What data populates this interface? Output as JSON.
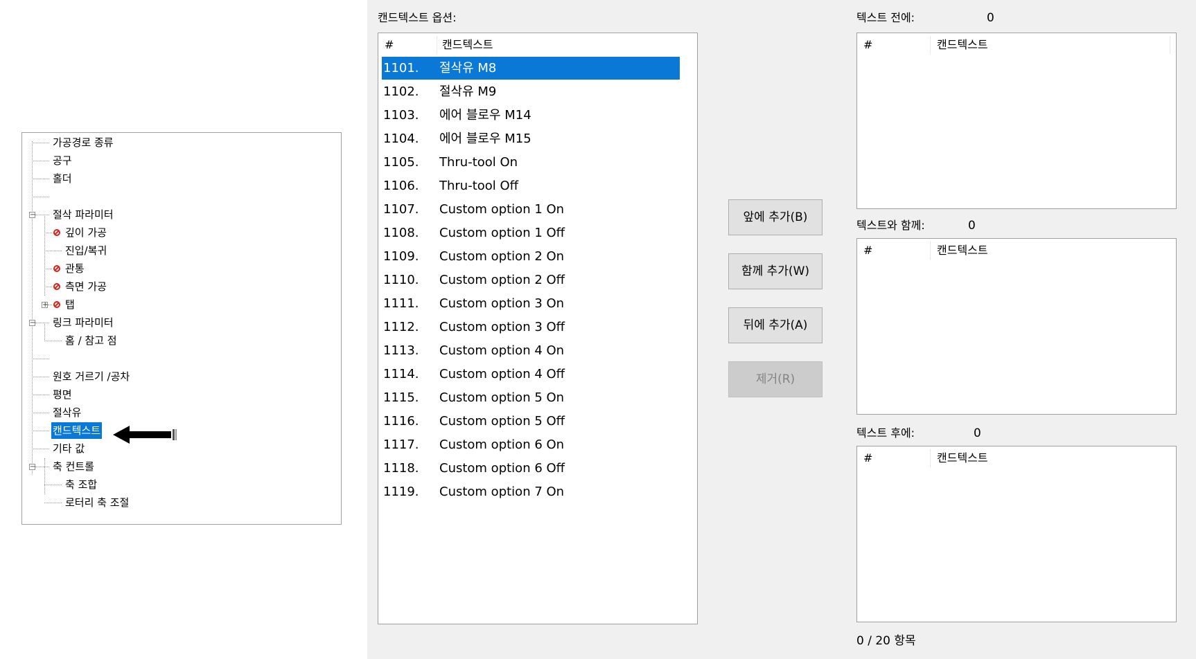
{
  "tree": {
    "items": [
      {
        "label": "가공경로 종류"
      },
      {
        "label": "공구"
      },
      {
        "label": "홀더"
      },
      {
        "label": ""
      },
      {
        "label": "절삭 파라미터"
      },
      {
        "label": "깊이 가공"
      },
      {
        "label": "진입/복귀"
      },
      {
        "label": "관통"
      },
      {
        "label": "측면 가공"
      },
      {
        "label": "탭"
      },
      {
        "label": "링크 파라미터"
      },
      {
        "label": "홈 / 참고 점"
      },
      {
        "label": ""
      },
      {
        "label": "원호 거르기 /공차"
      },
      {
        "label": "평면"
      },
      {
        "label": "절삭유"
      },
      {
        "label": "캔드텍스트"
      },
      {
        "label": "기타 값"
      },
      {
        "label": "축 컨트롤"
      },
      {
        "label": "축 조합"
      },
      {
        "label": "로터리 축 조절"
      }
    ],
    "selected_index": 16,
    "error_icons": [
      "error-icon"
    ]
  },
  "options": {
    "caption": "캔드텍스트 옵션:",
    "header_num": "#",
    "header_text": "캔드텍스트",
    "rows": [
      {
        "num": "1101.",
        "text": "절삭유 M8"
      },
      {
        "num": "1102.",
        "text": "절삭유 M9"
      },
      {
        "num": "1103.",
        "text": "에어 블로우 M14"
      },
      {
        "num": "1104.",
        "text": "에어 블로우 M15"
      },
      {
        "num": "1105.",
        "text": "Thru-tool On"
      },
      {
        "num": "1106.",
        "text": "Thru-tool Off"
      },
      {
        "num": "1107.",
        "text": "Custom option 1 On"
      },
      {
        "num": "1108.",
        "text": "Custom option 1 Off"
      },
      {
        "num": "1109.",
        "text": "Custom option 2 On"
      },
      {
        "num": "1110.",
        "text": "Custom option 2 Off"
      },
      {
        "num": "1111.",
        "text": "Custom option 3 On"
      },
      {
        "num": "1112.",
        "text": "Custom option 3 Off"
      },
      {
        "num": "1113.",
        "text": "Custom option 4 On"
      },
      {
        "num": "1114.",
        "text": "Custom option 4 Off"
      },
      {
        "num": "1115.",
        "text": "Custom option 5 On"
      },
      {
        "num": "1116.",
        "text": "Custom option 5 Off"
      },
      {
        "num": "1117.",
        "text": "Custom option 6 On"
      },
      {
        "num": "1118.",
        "text": "Custom option 6 Off"
      },
      {
        "num": "1119.",
        "text": "Custom option 7 On"
      }
    ],
    "selected_index": 0
  },
  "buttons": {
    "add_before": "앞에 추가(B)",
    "add_with": "함께 추가(W)",
    "add_after": "뒤에 추가(A)",
    "remove": "제거(R)"
  },
  "before": {
    "caption": "텍스트 전에:",
    "count": "0",
    "header_num": "#",
    "header_text": "캔드텍스트"
  },
  "with": {
    "caption": "텍스트와 함께:",
    "count": "0",
    "header_num": "#",
    "header_text": "캔드텍스트"
  },
  "after": {
    "caption": "텍스트 후에:",
    "count": "0",
    "header_num": "#",
    "header_text": "캔드텍스트"
  },
  "footer": {
    "item_count": "0 / 20 항목"
  },
  "colors": {
    "selection": "#0a78d7",
    "panel_gray": "#f0f0f0",
    "error_red": "#e0201a"
  }
}
